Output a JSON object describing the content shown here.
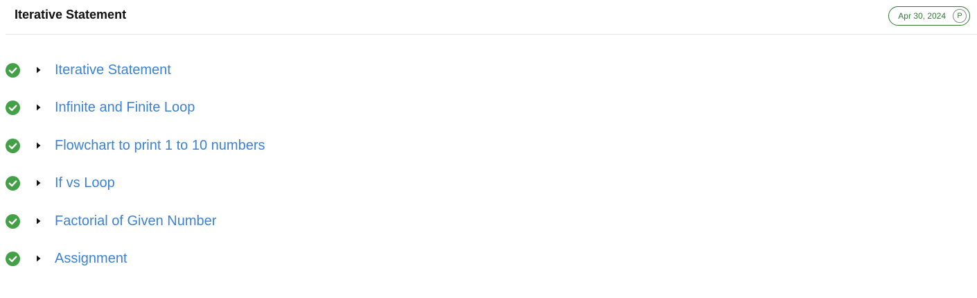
{
  "header": {
    "title": "Iterative Statement",
    "date": "Apr 30, 2024",
    "badge_letter": "P"
  },
  "colors": {
    "check_green": "#43a047",
    "link_blue": "#3b82d6",
    "badge_green": "#2e7d32"
  },
  "icons": {
    "completed": "check-circle-icon",
    "expand": "caret-right-icon"
  },
  "topics": [
    {
      "label": "Iterative Statement",
      "status": "completed"
    },
    {
      "label": "Infinite and Finite Loop",
      "status": "completed"
    },
    {
      "label": "Flowchart to print 1 to 10 numbers",
      "status": "completed"
    },
    {
      "label": "If vs Loop",
      "status": "completed"
    },
    {
      "label": "Factorial of Given Number",
      "status": "completed"
    },
    {
      "label": "Assignment",
      "status": "completed"
    }
  ]
}
